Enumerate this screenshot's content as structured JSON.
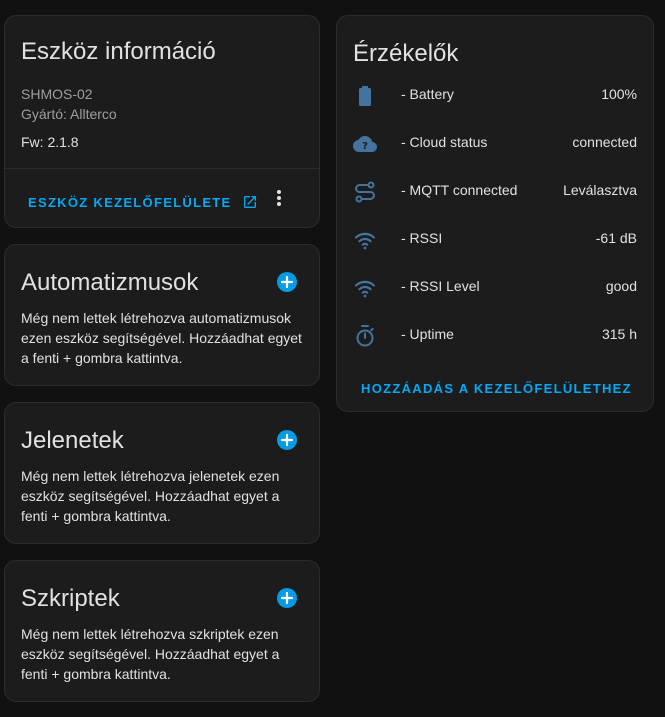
{
  "device_info": {
    "title": "Eszköz információ",
    "model": "SHMOS-02",
    "manufacturer": "Gyártó: Allterco",
    "firmware": "Fw: 2.1.8",
    "ui_link": "ESZKÖZ KEZELŐFELÜLETE"
  },
  "automations": {
    "title": "Automatizmusok",
    "description": "Még nem lettek létrehozva automatizmusok ezen eszköz segítségével. Hozzáadhat egyet a fenti + gombra kattintva."
  },
  "scenes": {
    "title": "Jelenetek",
    "description": "Még nem lettek létrehozva jelenetek ezen eszköz segítségével. Hozzáadhat egyet a fenti + gombra kattintva."
  },
  "scripts": {
    "title": "Szkriptek",
    "description": "Még nem lettek létrehozva szkriptek ezen eszköz segítségével. Hozzáadhat egyet a fenti + gombra kattintva."
  },
  "sensors": {
    "title": "Érzékelők",
    "items": [
      {
        "icon": "battery-icon",
        "name": "- Battery",
        "value": "100%"
      },
      {
        "icon": "cloud-question-icon",
        "name": "- Cloud status",
        "value": "connected"
      },
      {
        "icon": "connection-icon",
        "name": "- MQTT connected",
        "value": "Leválasztva"
      },
      {
        "icon": "wifi-icon",
        "name": "- RSSI",
        "value": "-61 dB"
      },
      {
        "icon": "wifi-icon",
        "name": "- RSSI Level",
        "value": "good"
      },
      {
        "icon": "timer-icon",
        "name": "- Uptime",
        "value": "315 h"
      }
    ],
    "add_link": "HOZZÁADÁS A KEZELŐFELÜLETHEZ"
  },
  "colors": {
    "background": "#111111",
    "card": "#1c1c1c",
    "accent": "#03a9f4",
    "icon": "#44739e"
  }
}
